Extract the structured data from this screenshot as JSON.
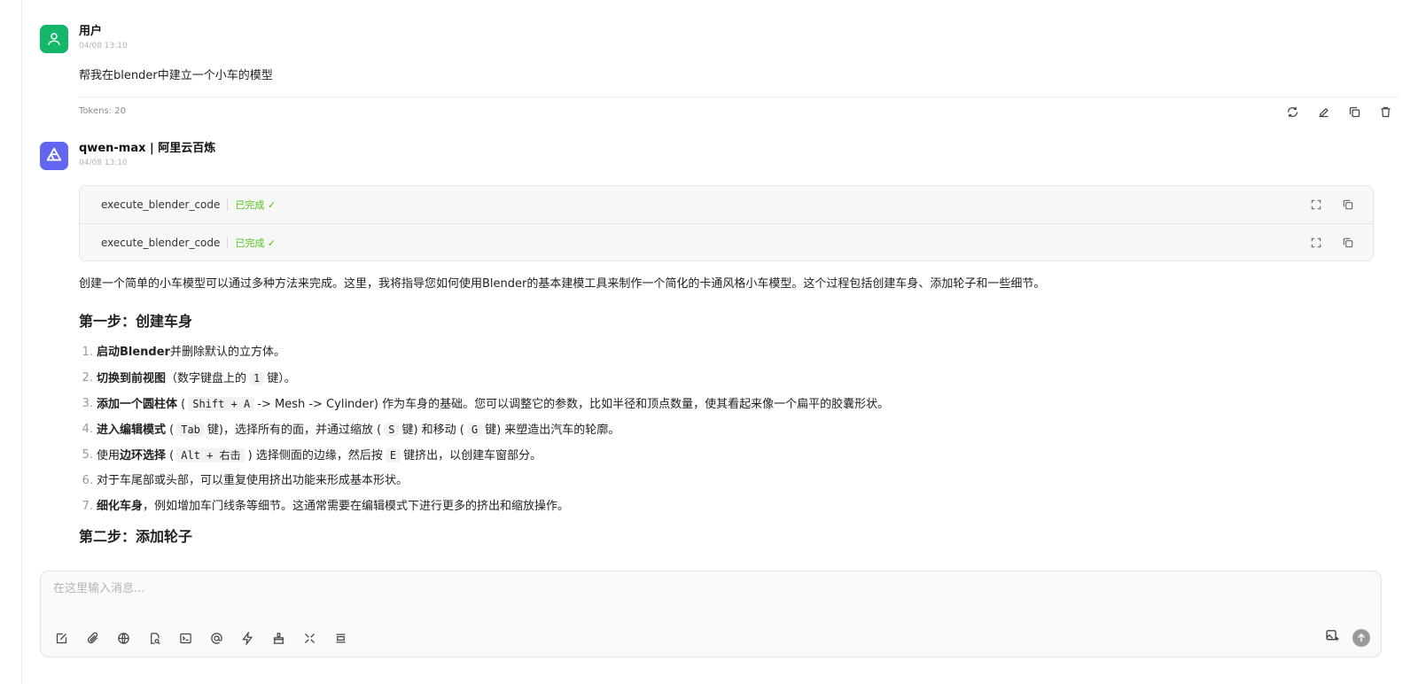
{
  "user_message": {
    "name": "用户",
    "time": "04/08 13:10",
    "text": "帮我在blender中建立一个小车的模型",
    "tokens": "Tokens: 20"
  },
  "assistant_message": {
    "name": "qwen-max | 阿里云百炼",
    "time": "04/08 13:10",
    "tool_calls": [
      {
        "name": "execute_blender_code",
        "status": "已完成 ✓"
      },
      {
        "name": "execute_blender_code",
        "status": "已完成 ✓"
      }
    ],
    "intro": "创建一个简单的小车模型可以通过多种方法来完成。这里，我将指导您如何使用Blender的基本建模工具来制作一个简化的卡通风格小车模型。这个过程包括创建车身、添加轮子和一些细节。",
    "step1_title": "第一步：创建车身",
    "steps": [
      {
        "num": "1.",
        "bold": "启动Blender",
        "rest": "并删除默认的立方体。"
      },
      {
        "num": "2.",
        "bold": "切换到前视图",
        "rest_a": "（数字键盘上的",
        "kbd": "1",
        "rest_b": "键）。"
      },
      {
        "num": "3.",
        "bold": "添加一个圆柱体",
        "rest_a": " (",
        "kbd": "Shift + A",
        "rest_b": "-> Mesh -> Cylinder) 作为车身的基础。您可以调整它的参数，比如半径和顶点数量，使其看起来像一个扁平的胶囊形状。"
      },
      {
        "num": "4.",
        "bold": "进入编辑模式",
        "rest_a": " (",
        "kbd": "Tab",
        "rest_b": "键)，选择所有的面，并通过缩放 (",
        "kbd2": "S",
        "rest_c": "键) 和移动 (",
        "kbd3": "G",
        "rest_d": "键) 来塑造出汽车的轮廓。"
      },
      {
        "num": "5.",
        "pre": "使用",
        "bold": "边环选择",
        "rest_a": " (",
        "kbd": "Alt + 右击",
        "rest_b": ") 选择侧面的边缘，然后按",
        "kbd2": "E",
        "rest_c": "键挤出，以创建车窗部分。"
      },
      {
        "num": "6.",
        "rest": "对于车尾部或头部，可以重复使用挤出功能来形成基本形状。"
      },
      {
        "num": "7.",
        "bold": "细化车身",
        "rest": "，例如增加车门线条等细节。这通常需要在编辑模式下进行更多的挤出和缩放操作。"
      }
    ],
    "step2_title": "第二步：添加轮子"
  },
  "composer": {
    "placeholder": "在这里输入消息..."
  },
  "colors": {
    "user_avatar": "#12b76a",
    "bot_avatar": "#6366f1",
    "success": "#52c41a"
  }
}
